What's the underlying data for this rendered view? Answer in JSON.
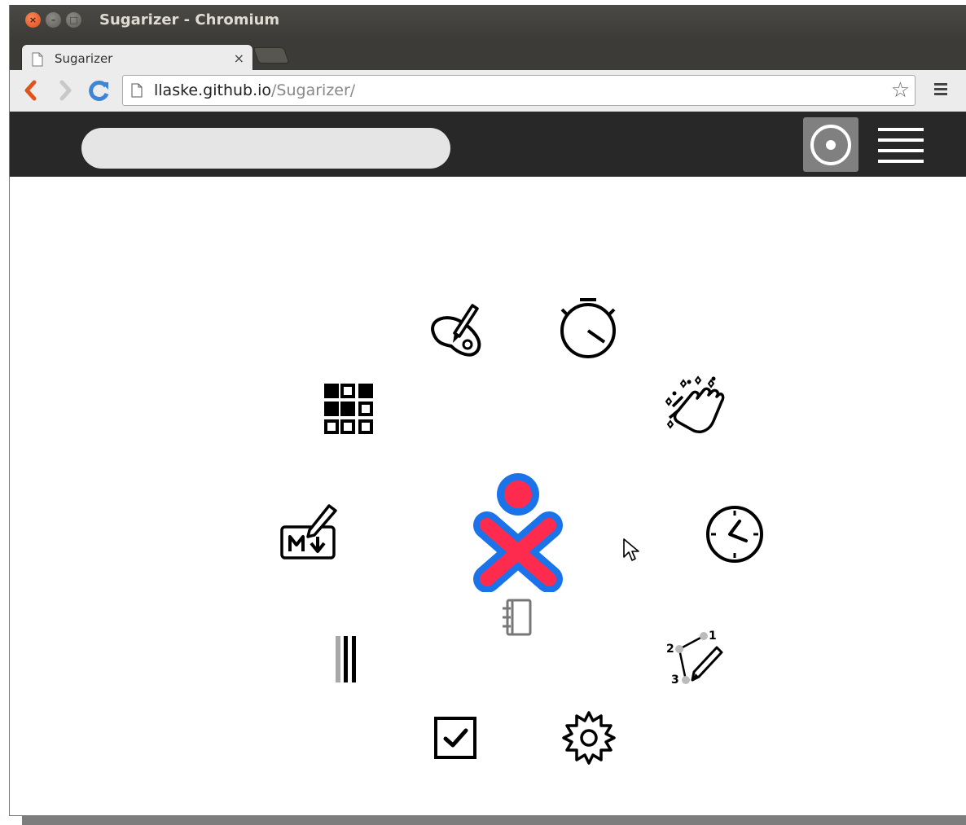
{
  "window": {
    "title": "Sugarizer - Chromium"
  },
  "tab": {
    "title": "Sugarizer",
    "close_label": "×"
  },
  "address": {
    "host": "llaske.github.io",
    "path": "/Sugarizer/"
  },
  "toolbar": {
    "menu_icon": "hamburger-menu-icon"
  },
  "appbar": {
    "search_placeholder": "",
    "home_icon": "radial-view-icon",
    "list_icon": "list-view-icon"
  },
  "home": {
    "owner_icon": "xo-owner-icon",
    "journal_icon": "journal-icon",
    "activities": [
      {
        "icon": "paint-palette-icon"
      },
      {
        "icon": "stopwatch-icon"
      },
      {
        "icon": "clapping-hands-icon"
      },
      {
        "icon": "clock-icon"
      },
      {
        "icon": "connect-the-dots-icon"
      },
      {
        "icon": "settings-gear-icon"
      },
      {
        "icon": "checkbox-icon"
      },
      {
        "icon": "abacus-bars-icon"
      },
      {
        "icon": "markdown-editor-icon"
      },
      {
        "icon": "grid-memorize-icon"
      }
    ],
    "dots_labels": [
      "1",
      "2",
      "3"
    ]
  },
  "colors": {
    "appbar": "#282828",
    "xo_stroke": "#1a73e8",
    "xo_fill": "#ff2b4f"
  }
}
